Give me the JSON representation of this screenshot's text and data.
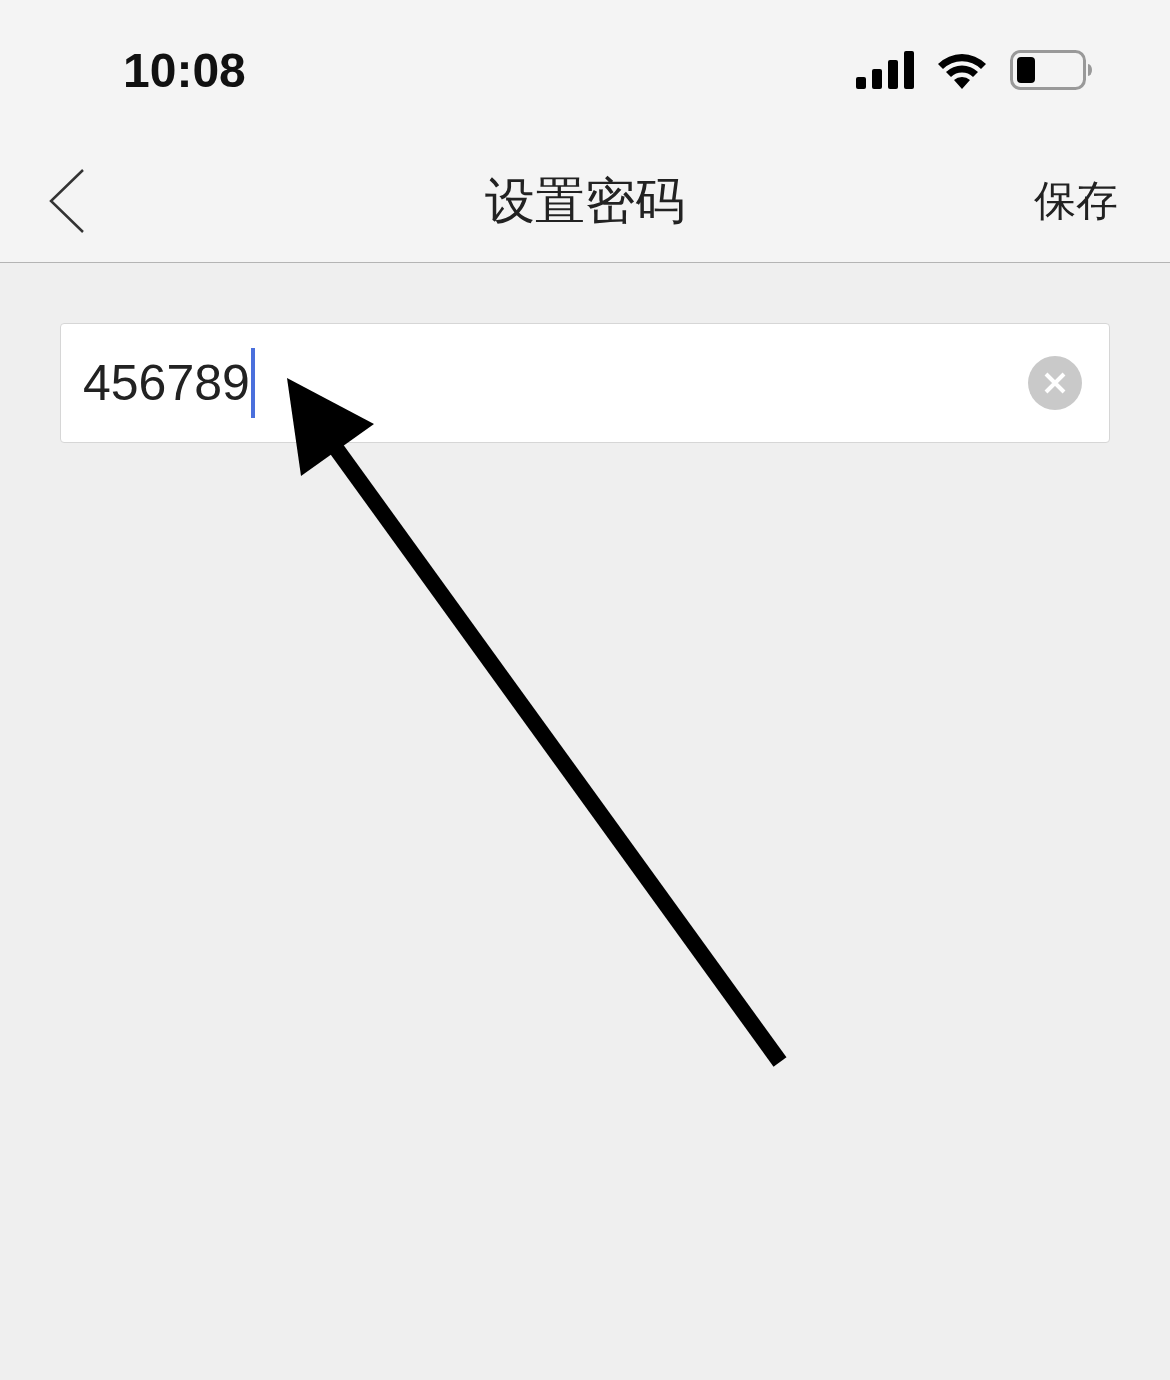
{
  "status_bar": {
    "time": "10:08"
  },
  "nav_bar": {
    "title": "设置密码",
    "action": "保存"
  },
  "password_field": {
    "value": "456789",
    "focused": true
  }
}
